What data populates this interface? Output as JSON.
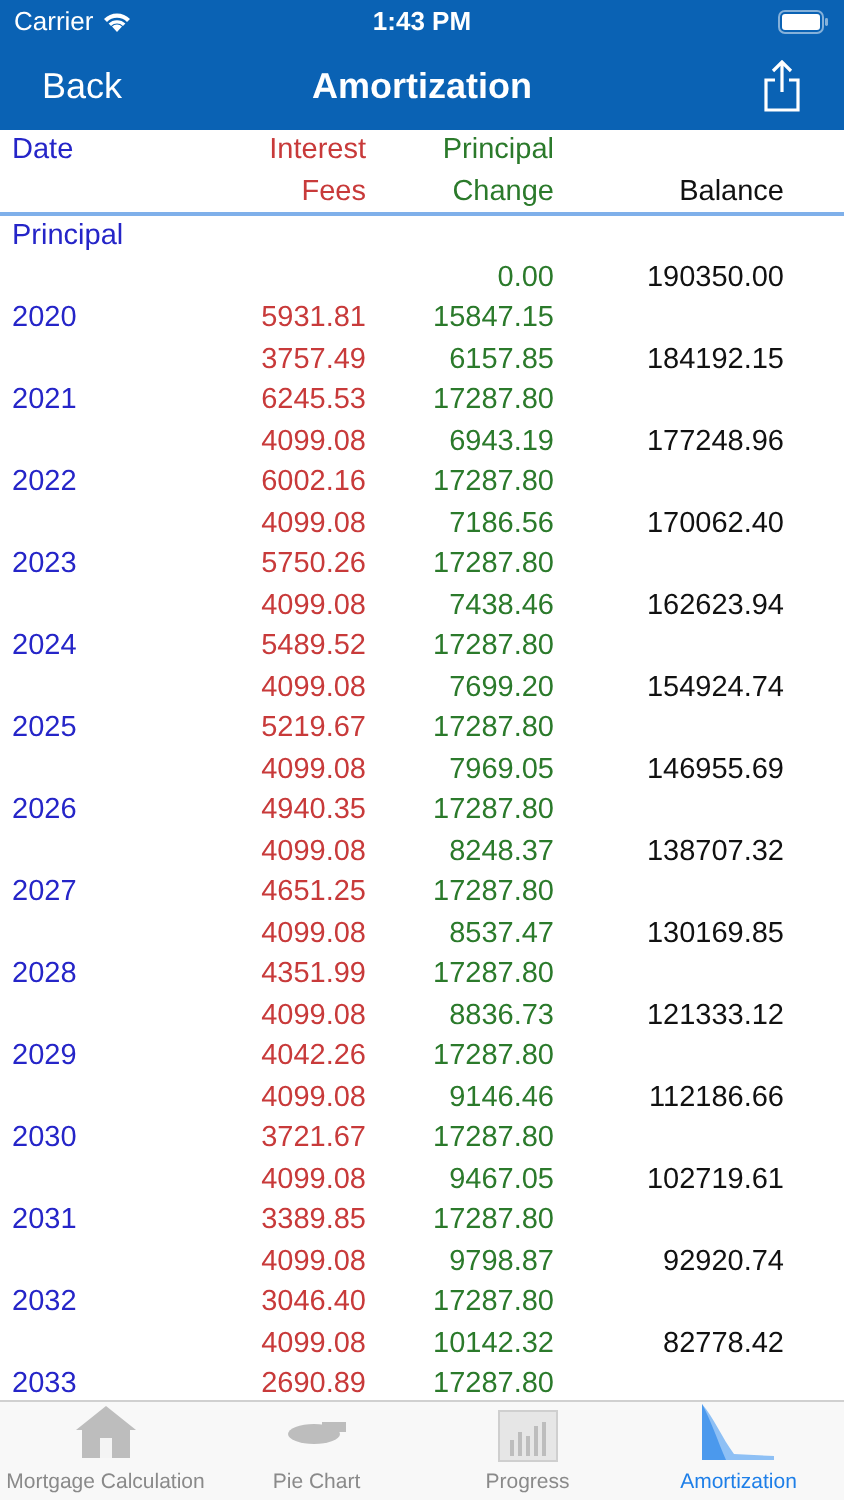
{
  "status_bar": {
    "carrier": "Carrier",
    "time": "1:43 PM"
  },
  "nav_bar": {
    "back": "Back",
    "title": "Amortization"
  },
  "columns": {
    "date": "Date",
    "interest": [
      "Interest",
      "Fees"
    ],
    "principal": [
      "Principal",
      "Change"
    ],
    "balance": "Balance"
  },
  "principal_row": {
    "label": "Principal",
    "change": "0.00",
    "balance": "190350.00"
  },
  "rows": [
    {
      "year": "2020",
      "interest": "5931.81",
      "fees": "3757.49",
      "principal": "15847.15",
      "change": "6157.85",
      "balance": "184192.15"
    },
    {
      "year": "2021",
      "interest": "6245.53",
      "fees": "4099.08",
      "principal": "17287.80",
      "change": "6943.19",
      "balance": "177248.96"
    },
    {
      "year": "2022",
      "interest": "6002.16",
      "fees": "4099.08",
      "principal": "17287.80",
      "change": "7186.56",
      "balance": "170062.40"
    },
    {
      "year": "2023",
      "interest": "5750.26",
      "fees": "4099.08",
      "principal": "17287.80",
      "change": "7438.46",
      "balance": "162623.94"
    },
    {
      "year": "2024",
      "interest": "5489.52",
      "fees": "4099.08",
      "principal": "17287.80",
      "change": "7699.20",
      "balance": "154924.74"
    },
    {
      "year": "2025",
      "interest": "5219.67",
      "fees": "4099.08",
      "principal": "17287.80",
      "change": "7969.05",
      "balance": "146955.69"
    },
    {
      "year": "2026",
      "interest": "4940.35",
      "fees": "4099.08",
      "principal": "17287.80",
      "change": "8248.37",
      "balance": "138707.32"
    },
    {
      "year": "2027",
      "interest": "4651.25",
      "fees": "4099.08",
      "principal": "17287.80",
      "change": "8537.47",
      "balance": "130169.85"
    },
    {
      "year": "2028",
      "interest": "4351.99",
      "fees": "4099.08",
      "principal": "17287.80",
      "change": "8836.73",
      "balance": "121333.12"
    },
    {
      "year": "2029",
      "interest": "4042.26",
      "fees": "4099.08",
      "principal": "17287.80",
      "change": "9146.46",
      "balance": "112186.66"
    },
    {
      "year": "2030",
      "interest": "3721.67",
      "fees": "4099.08",
      "principal": "17287.80",
      "change": "9467.05",
      "balance": "102719.61"
    },
    {
      "year": "2031",
      "interest": "3389.85",
      "fees": "4099.08",
      "principal": "17287.80",
      "change": "9798.87",
      "balance": "92920.74"
    },
    {
      "year": "2032",
      "interest": "3046.40",
      "fees": "4099.08",
      "principal": "17287.80",
      "change": "10142.32",
      "balance": "82778.42"
    },
    {
      "year": "2033",
      "interest": "2690.89",
      "principal": "17287.80"
    }
  ],
  "tabs": [
    {
      "label": "Mortgage Calculation",
      "kind": "house",
      "selected": false
    },
    {
      "label": "Pie Chart",
      "kind": "pie",
      "selected": false
    },
    {
      "label": "Progress",
      "kind": "bars",
      "selected": false
    },
    {
      "label": "Amortization",
      "kind": "area",
      "selected": true
    }
  ]
}
